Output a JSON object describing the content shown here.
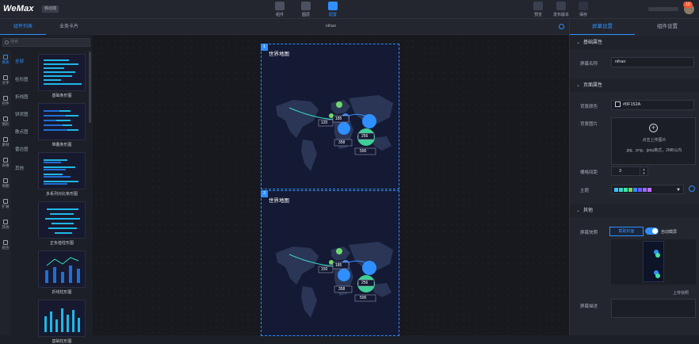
{
  "app": {
    "logo": "WeMax",
    "logo_badge": "移动端",
    "avatar_badge": "10"
  },
  "toolbar": {
    "tools": [
      {
        "label": "组件",
        "icon": "component-icon"
      },
      {
        "label": "图层",
        "icon": "layers-icon"
      },
      {
        "label": "配置",
        "icon": "settings-icon"
      }
    ],
    "right_tools": [
      {
        "label": "预览",
        "icon": "eye-icon"
      },
      {
        "label": "发布版本",
        "icon": "publish-icon"
      },
      {
        "label": "保存",
        "icon": "save-icon"
      }
    ]
  },
  "left": {
    "tabs": [
      "组件列表",
      "业务卡片"
    ],
    "search_placeholder": "搜索",
    "rail": [
      {
        "label": "图表",
        "icon": "chart-icon"
      },
      {
        "label": "文字",
        "icon": "text-icon"
      },
      {
        "label": "控件",
        "icon": "control-icon"
      },
      {
        "label": "图形",
        "icon": "shape-icon"
      },
      {
        "label": "素材",
        "icon": "media-icon"
      },
      {
        "label": "表格",
        "icon": "table-icon"
      },
      {
        "label": "地图",
        "icon": "map-icon"
      },
      {
        "label": "扩展",
        "icon": "extend-icon"
      },
      {
        "label": "其他",
        "icon": "other-icon"
      },
      {
        "label": "组合",
        "icon": "group-icon"
      }
    ],
    "categories": [
      "全部",
      "柱形图",
      "折线图",
      "饼状图",
      "散点图",
      "雷达图",
      "其他"
    ],
    "thumbs": [
      {
        "label": "基础条形图"
      },
      {
        "label": "堆叠条形图"
      },
      {
        "label": "多系列对比条形图"
      },
      {
        "label": "正负值柱形图"
      },
      {
        "label": "折线柱形图"
      },
      {
        "label": "基础柱形图"
      }
    ]
  },
  "canvas": {
    "title": "nihao",
    "widgets": [
      {
        "num": "1",
        "title": "世界地图",
        "labels": [
          "120",
          "185",
          "256",
          "358",
          "500"
        ]
      },
      {
        "num": "2",
        "title": "世界地图",
        "labels": [
          "150",
          "185",
          "256",
          "358",
          "500"
        ]
      }
    ]
  },
  "right": {
    "tabs": [
      "屏幕设置",
      "组件设置"
    ],
    "sections": [
      "基础属性",
      "页面属性",
      "其他"
    ],
    "screen_name_label": "屏幕名称",
    "screen_name_value": "nihao",
    "bg_color_label": "背景颜色",
    "bg_color_value": "#0F152A",
    "bg_image_label": "背景图片",
    "upload_hint": "点击上传图片",
    "upload_formats": "jpg、png、jpeg格式，2MB以内",
    "grid_label": "栅格间距",
    "grid_value": "3",
    "theme_label": "主题",
    "theme_colors": [
      "#3ec1ff",
      "#35d6c6",
      "#41e3a0",
      "#6fd86b",
      "#3b86ff",
      "#6e5cff",
      "#9a6bff",
      "#c46bff"
    ],
    "cover_label": "屏幕快照",
    "cover_btn": "截取封面",
    "cover_toggle": "自动截屏",
    "upload_cover": "上传快照",
    "desc_label": "屏幕描述"
  }
}
